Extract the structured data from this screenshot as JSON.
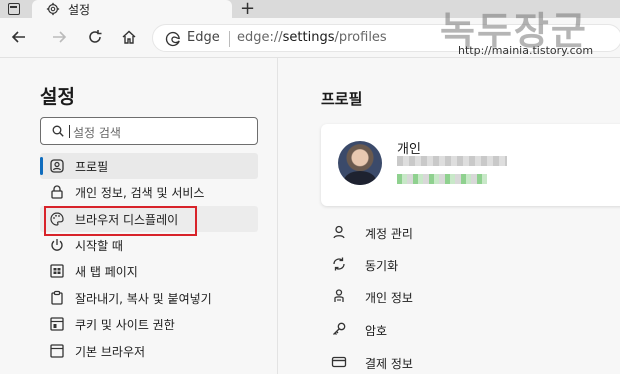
{
  "tab": {
    "title": "설정"
  },
  "address": {
    "browser_label": "Edge",
    "url_prefix": "edge://",
    "url_host": "settings",
    "url_path": "/profiles"
  },
  "watermark": {
    "title": "녹두장군",
    "url": "http://mainia.tistory.com"
  },
  "sidebar": {
    "title": "설정",
    "search_placeholder": "설정 검색",
    "items": [
      {
        "label": "프로필",
        "icon": "profile-icon"
      },
      {
        "label": "개인 정보, 검색 및 서비스",
        "icon": "lock-icon"
      },
      {
        "label": "브라우저 디스플레이",
        "icon": "palette-icon"
      },
      {
        "label": "시작할 때",
        "icon": "power-icon"
      },
      {
        "label": "새 탭 페이지",
        "icon": "new-tab-icon"
      },
      {
        "label": "잘라내기, 복사 및 붙여넣기",
        "icon": "clipboard-icon"
      },
      {
        "label": "쿠키 및 사이트 권한",
        "icon": "site-permissions-icon"
      },
      {
        "label": "기본 브라우저",
        "icon": "browser-icon"
      }
    ]
  },
  "main": {
    "title": "프로필",
    "profile_name": "개인",
    "menu": [
      {
        "label": "계정 관리",
        "icon": "account-icon"
      },
      {
        "label": "동기화",
        "icon": "sync-icon"
      },
      {
        "label": "개인 정보",
        "icon": "personal-info-icon"
      },
      {
        "label": "암호",
        "icon": "key-icon"
      },
      {
        "label": "결제 정보",
        "icon": "card-icon"
      }
    ]
  },
  "colors": {
    "accent": "#0f6cbd",
    "highlight": "#d8232a"
  }
}
